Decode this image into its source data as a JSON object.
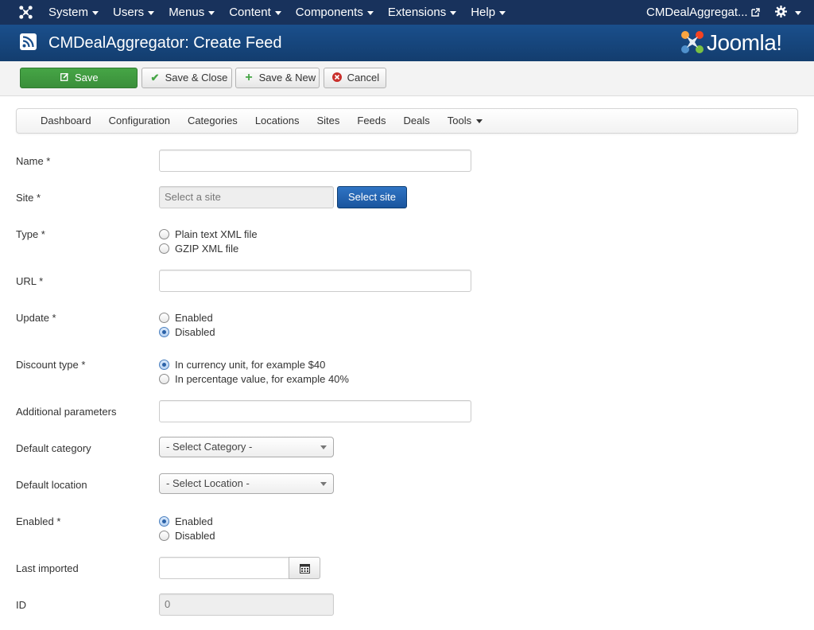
{
  "topbar": {
    "menu": [
      "System",
      "Users",
      "Menus",
      "Content",
      "Components",
      "Extensions",
      "Help"
    ],
    "site_name": "CMDealAggregat..."
  },
  "header": {
    "title": "CMDealAggregator: Create Feed",
    "brand": "Joomla!"
  },
  "toolbar": {
    "save": "Save",
    "save_close": "Save & Close",
    "save_new": "Save & New",
    "cancel": "Cancel"
  },
  "submenu": {
    "items": [
      "Dashboard",
      "Configuration",
      "Categories",
      "Locations",
      "Sites",
      "Feeds",
      "Deals"
    ],
    "tools": "Tools"
  },
  "form": {
    "name": {
      "label": "Name *",
      "value": ""
    },
    "site": {
      "label": "Site *",
      "placeholder": "Select a site",
      "button": "Select site"
    },
    "type": {
      "label": "Type *",
      "options": [
        "Plain text XML file",
        "GZIP XML file"
      ],
      "selected": null
    },
    "url": {
      "label": "URL *",
      "value": ""
    },
    "update": {
      "label": "Update *",
      "options": [
        "Enabled",
        "Disabled"
      ],
      "selected": "Disabled"
    },
    "discount_type": {
      "label": "Discount type *",
      "options": [
        "In currency unit, for example $40",
        "In percentage value, for example 40%"
      ],
      "selected": "In currency unit, for example $40"
    },
    "additional_parameters": {
      "label": "Additional parameters",
      "value": ""
    },
    "default_category": {
      "label": "Default category",
      "selected": "- Select Category -"
    },
    "default_location": {
      "label": "Default location",
      "selected": "- Select Location -"
    },
    "enabled": {
      "label": "Enabled *",
      "options": [
        "Enabled",
        "Disabled"
      ],
      "selected": "Enabled"
    },
    "last_imported": {
      "label": "Last imported",
      "value": ""
    },
    "id": {
      "label": "ID",
      "value": "0"
    }
  },
  "colors": {
    "topbar_bg": "#18325c",
    "header_bg": "#1a4f8c",
    "save_green": "#46a546",
    "primary_blue": "#2f74c4",
    "cancel_red": "#c9302c"
  }
}
